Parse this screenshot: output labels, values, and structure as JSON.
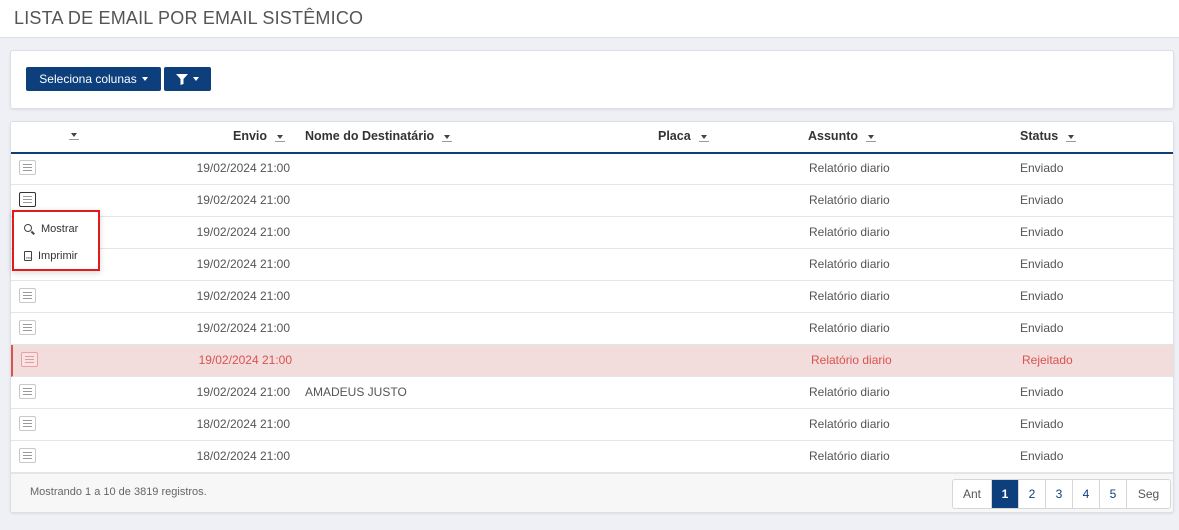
{
  "page": {
    "title": "LISTA DE EMAIL POR EMAIL SISTÊMICO"
  },
  "toolbar": {
    "columns_label": "Seleciona colunas",
    "filter_icon": "filter-icon"
  },
  "table": {
    "headers": {
      "envio": "Envio",
      "nome": "Nome do Destinatário",
      "placa": "Placa",
      "assunto": "Assunto",
      "status": "Status"
    },
    "rows": [
      {
        "envio": "19/02/2024 21:00",
        "nome": "",
        "placa": "",
        "assunto": "Relatório diario",
        "status": "Enviado"
      },
      {
        "envio": "19/02/2024 21:00",
        "nome": "",
        "placa": "",
        "assunto": "Relatório diario",
        "status": "Enviado"
      },
      {
        "envio": "19/02/2024 21:00",
        "nome": "",
        "placa": "",
        "assunto": "Relatório diario",
        "status": "Enviado"
      },
      {
        "envio": "19/02/2024 21:00",
        "nome": "",
        "placa": "",
        "assunto": "Relatório diario",
        "status": "Enviado"
      },
      {
        "envio": "19/02/2024 21:00",
        "nome": "",
        "placa": "",
        "assunto": "Relatório diario",
        "status": "Enviado"
      },
      {
        "envio": "19/02/2024 21:00",
        "nome": "",
        "placa": "",
        "assunto": "Relatório diario",
        "status": "Enviado"
      },
      {
        "envio": "19/02/2024 21:00",
        "nome": "",
        "placa": "",
        "assunto": "Relatório diario",
        "status": "Rejeitado"
      },
      {
        "envio": "19/02/2024 21:00",
        "nome": "AMADEUS JUSTO",
        "placa": "",
        "assunto": "Relatório diario",
        "status": "Enviado"
      },
      {
        "envio": "18/02/2024 21:00",
        "nome": "",
        "placa": "",
        "assunto": "Relatório diario",
        "status": "Enviado"
      },
      {
        "envio": "18/02/2024 21:00",
        "nome": "",
        "placa": "",
        "assunto": "Relatório diario",
        "status": "Enviado"
      }
    ]
  },
  "context_menu": {
    "show_label": "Mostrar",
    "print_label": "Imprimir"
  },
  "footer": {
    "info": "Mostrando 1 a 10 de 3819 registros.",
    "prev": "Ant",
    "pages": [
      "1",
      "2",
      "3",
      "4",
      "5"
    ],
    "next": "Seg",
    "current_page": "1"
  },
  "colors": {
    "primary": "#0d3f7d",
    "rejected_text": "#d9534f",
    "rejected_bg": "#f2dcdc",
    "highlight_border": "#e01b1b"
  }
}
